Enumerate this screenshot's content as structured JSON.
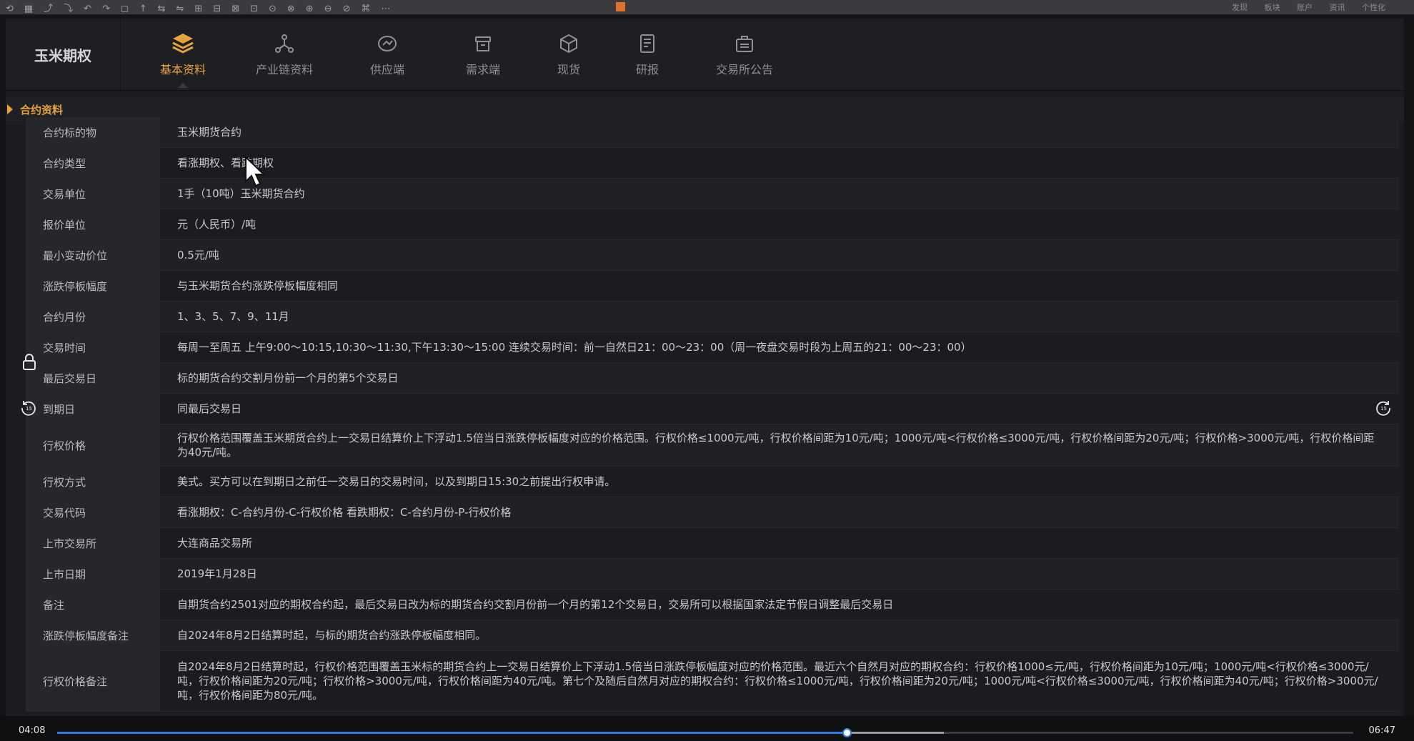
{
  "toolbar": {
    "menus": [
      "发现",
      "板块",
      "账户",
      "资讯",
      "个性化"
    ]
  },
  "brand": {
    "title": "玉米期权"
  },
  "nav": {
    "tabs": [
      {
        "label": "基本资料",
        "icon": "layers-icon",
        "active": true
      },
      {
        "label": "产业链资料",
        "icon": "chain-icon",
        "active": false
      },
      {
        "label": "供应端",
        "icon": "supply-icon",
        "active": false
      },
      {
        "label": "需求端",
        "icon": "demand-icon",
        "active": false
      },
      {
        "label": "现货",
        "icon": "box-icon",
        "active": false
      },
      {
        "label": "研报",
        "icon": "report-icon",
        "active": false
      },
      {
        "label": "交易所公告",
        "icon": "notice-icon",
        "active": false
      }
    ]
  },
  "section": {
    "title": "合约资料"
  },
  "rows": [
    {
      "label": "合约标的物",
      "value": "玉米期货合约"
    },
    {
      "label": "合约类型",
      "value": "看涨期权、看跌期权"
    },
    {
      "label": "交易单位",
      "value": "1手（10吨）玉米期货合约"
    },
    {
      "label": "报价单位",
      "value": "元（人民币）/吨"
    },
    {
      "label": "最小变动价位",
      "value": "0.5元/吨"
    },
    {
      "label": "涨跌停板幅度",
      "value": "与玉米期货合约涨跌停板幅度相同"
    },
    {
      "label": "合约月份",
      "value": "1、3、5、7、9、11月"
    },
    {
      "label": "交易时间",
      "value": "每周一至周五 上午9:00～10:15,10:30～11:30,下午13:30～15:00 连续交易时间：前一自然日21：00～23：00（周一夜盘交易时段为上周五的21：00～23：00）"
    },
    {
      "label": "最后交易日",
      "value": "标的期货合约交割月份前一个月的第5个交易日"
    },
    {
      "label": "到期日",
      "value": "同最后交易日"
    },
    {
      "label": "行权价格",
      "value": "行权价格范围覆盖玉米期货合约上一交易日结算价上下浮动1.5倍当日涨跌停板幅度对应的价格范围。行权价格≤1000元/吨，行权价格间距为10元/吨；1000元/吨<行权价格≤3000元/吨，行权价格间距为20元/吨；行权价格>3000元/吨，行权价格间距为40元/吨。"
    },
    {
      "label": "行权方式",
      "value": "美式。买方可以在到期日之前任一交易日的交易时间，以及到期日15:30之前提出行权申请。"
    },
    {
      "label": "交易代码",
      "value": "看涨期权：C-合约月份-C-行权价格 看跌期权：C-合约月份-P-行权价格"
    },
    {
      "label": "上市交易所",
      "value": "大连商品交易所"
    },
    {
      "label": "上市日期",
      "value": "2019年1月28日"
    },
    {
      "label": "备注",
      "value": "自期货合约2501对应的期权合约起，最后交易日改为标的期货合约交割月份前一个月的第12个交易日，交易所可以根据国家法定节假日调整最后交易日"
    },
    {
      "label": "涨跌停板幅度备注",
      "value": "自2024年8月2日结算时起，与标的期货合约涨跌停板幅度相同。"
    },
    {
      "label": "行权价格备注",
      "value": "自2024年8月2日结算时起，行权价格范围覆盖玉米标的期货合约上一交易日结算价上下浮动1.5倍当日涨跌停板幅度对应的价格范围。最近六个自然月对应的期权合约：行权价格1000≤元/吨，行权价格间距为10元/吨；1000元/吨<行权价格≤3000元/吨，行权价格间距为20元/吨；行权价格>3000元/吨，行权价格间距为40元/吨。第七个及随后自然月对应的期权合约：行权价格≤1000元/吨，行权价格间距为20元/吨；1000元/吨<行权价格≤3000元/吨，行权价格间距为40元/吨；行权价格>3000元/吨，行权价格间距为80元/吨。"
    }
  ],
  "player": {
    "current_time": "04:08",
    "total_time": "06:47",
    "progress": 0.609,
    "buffered": 0.684
  },
  "colors": {
    "accent": "#e6a23c",
    "progress": "#2f7de1"
  }
}
